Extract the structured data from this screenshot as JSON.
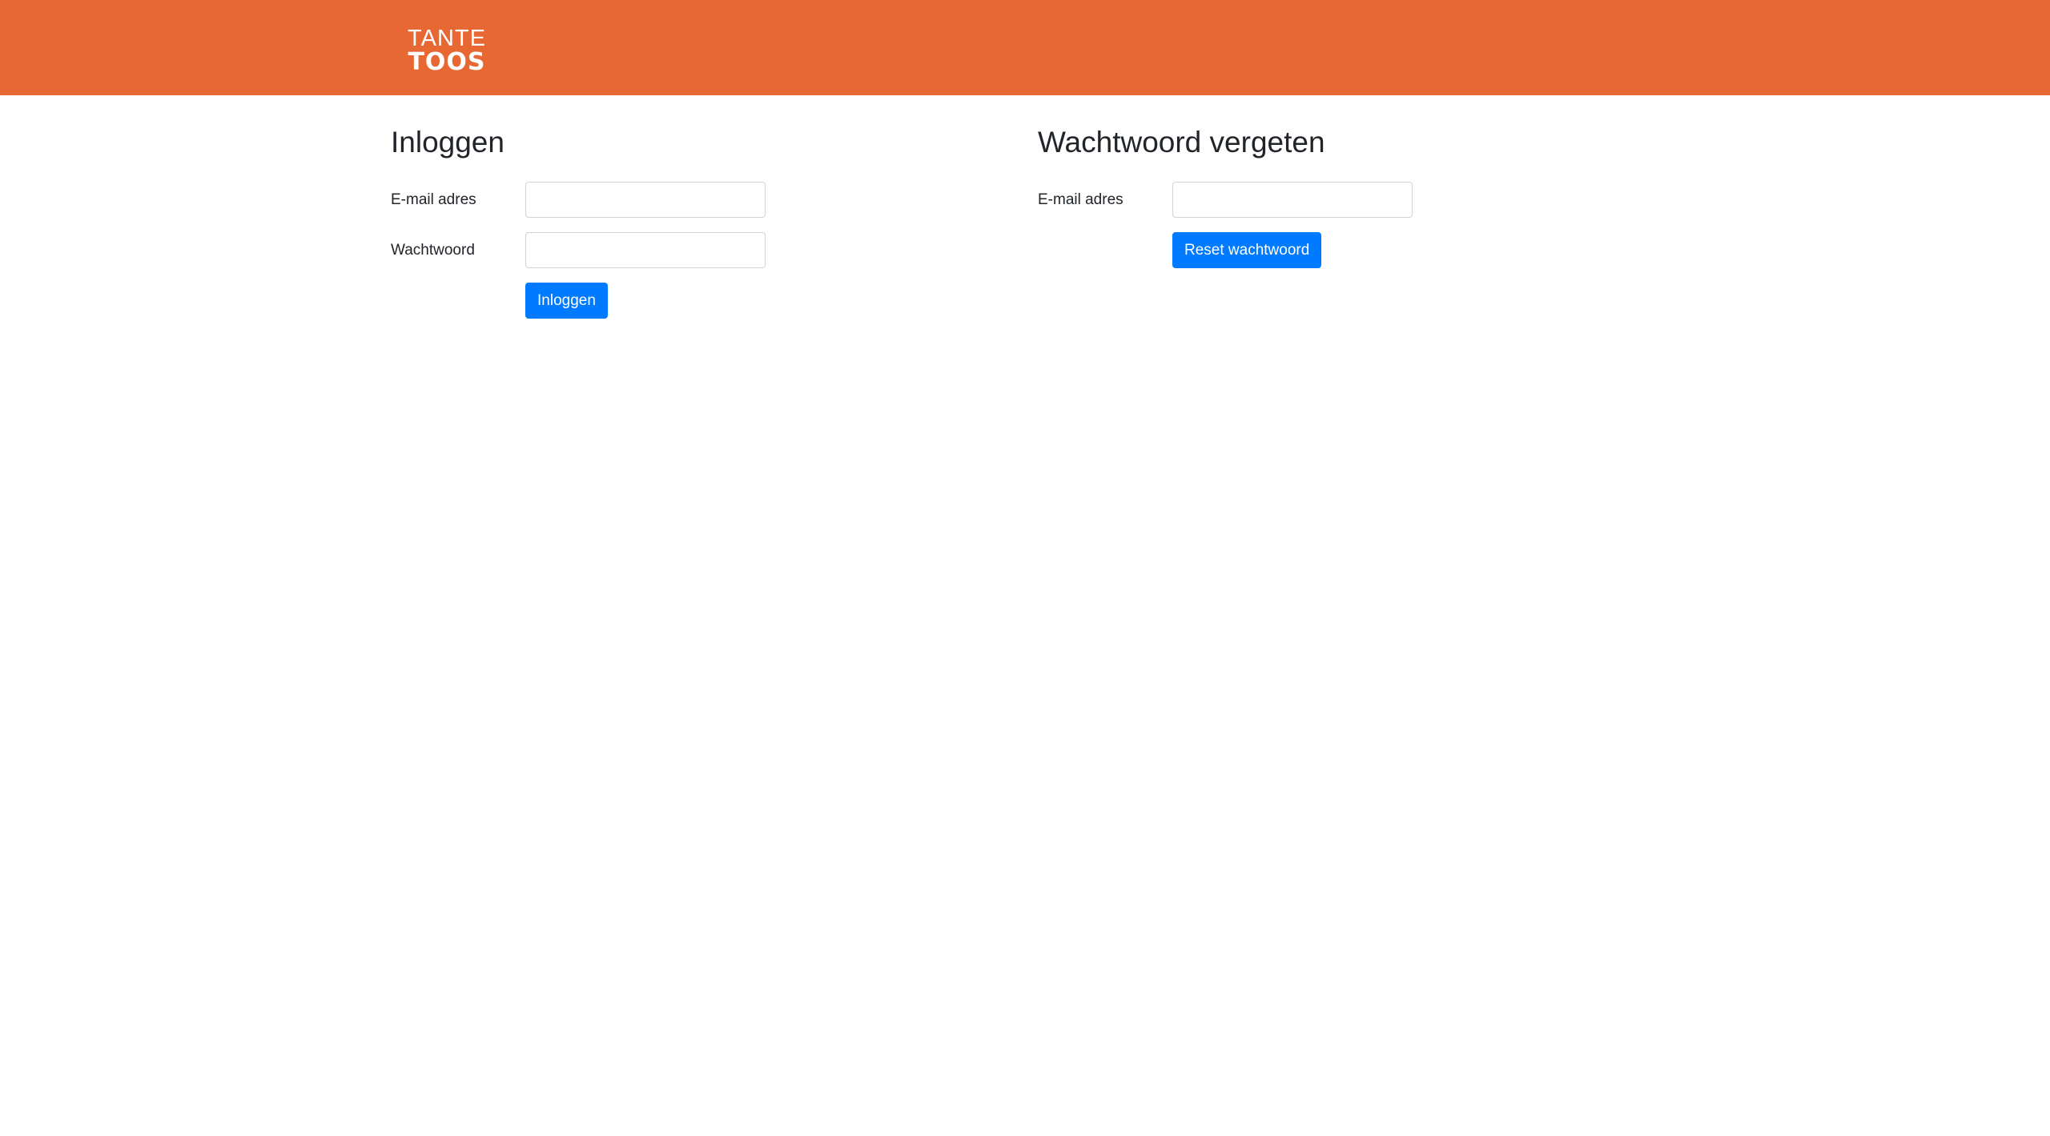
{
  "header": {
    "brand_color": "#e86834",
    "logo": {
      "line1": "TANTE",
      "line2": "TOOS"
    }
  },
  "login": {
    "title": "Inloggen",
    "email_label": "E-mail adres",
    "email_value": "",
    "password_label": "Wachtwoord",
    "password_value": "",
    "submit_label": "Inloggen"
  },
  "forgot": {
    "title": "Wachtwoord vergeten",
    "email_label": "E-mail adres",
    "email_value": "",
    "submit_label": "Reset wachtwoord"
  },
  "colors": {
    "primary_button": "#007bff",
    "input_border": "#ced4da"
  }
}
